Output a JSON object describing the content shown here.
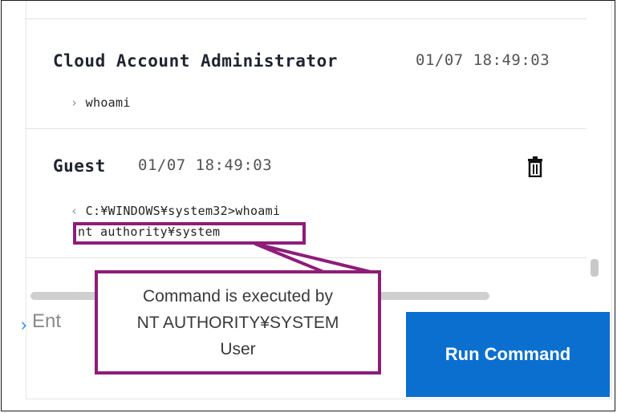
{
  "messages": [
    {
      "author": "Cloud Account Administrator",
      "time": "01/07 18:49:03",
      "lines": [
        "whoami"
      ]
    },
    {
      "author": "Guest",
      "time": "01/07 18:49:03",
      "lines": [
        "C:¥WINDOWS¥system32>whoami",
        "nt authority¥system"
      ]
    }
  ],
  "input": {
    "placeholder": "Ent"
  },
  "run_button": {
    "label": "Run Command"
  },
  "callout": {
    "line1": "Command is executed by",
    "line2": "NT AUTHORITY¥SYSTEM",
    "line3": "User"
  },
  "colors": {
    "accent": "#0b6fcf",
    "callout": "#8e1d78"
  },
  "icons": {
    "delete": "trash-icon",
    "prompt": "chevron-right-icon"
  }
}
